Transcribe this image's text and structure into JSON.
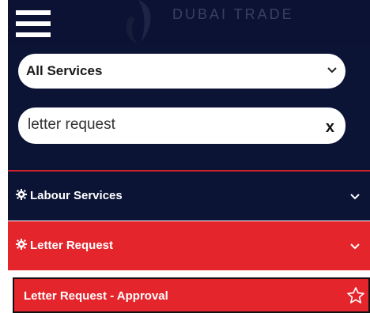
{
  "header": {
    "logo_text": "DUBAI TRADE"
  },
  "filters": {
    "service_select": "All Services",
    "search_value": "letter request",
    "clear_label": "x"
  },
  "accordion": [
    {
      "label": "Labour Services",
      "icon": "gear-icon",
      "expanded": false
    },
    {
      "label": "Letter Request",
      "icon": "gear-icon",
      "expanded": true
    }
  ],
  "sub_items": [
    {
      "label": "Letter Request - Approval",
      "icon": "star-outline-icon"
    }
  ],
  "colors": {
    "navy": "#0c1436",
    "red": "#e5252c",
    "white": "#ffffff"
  }
}
